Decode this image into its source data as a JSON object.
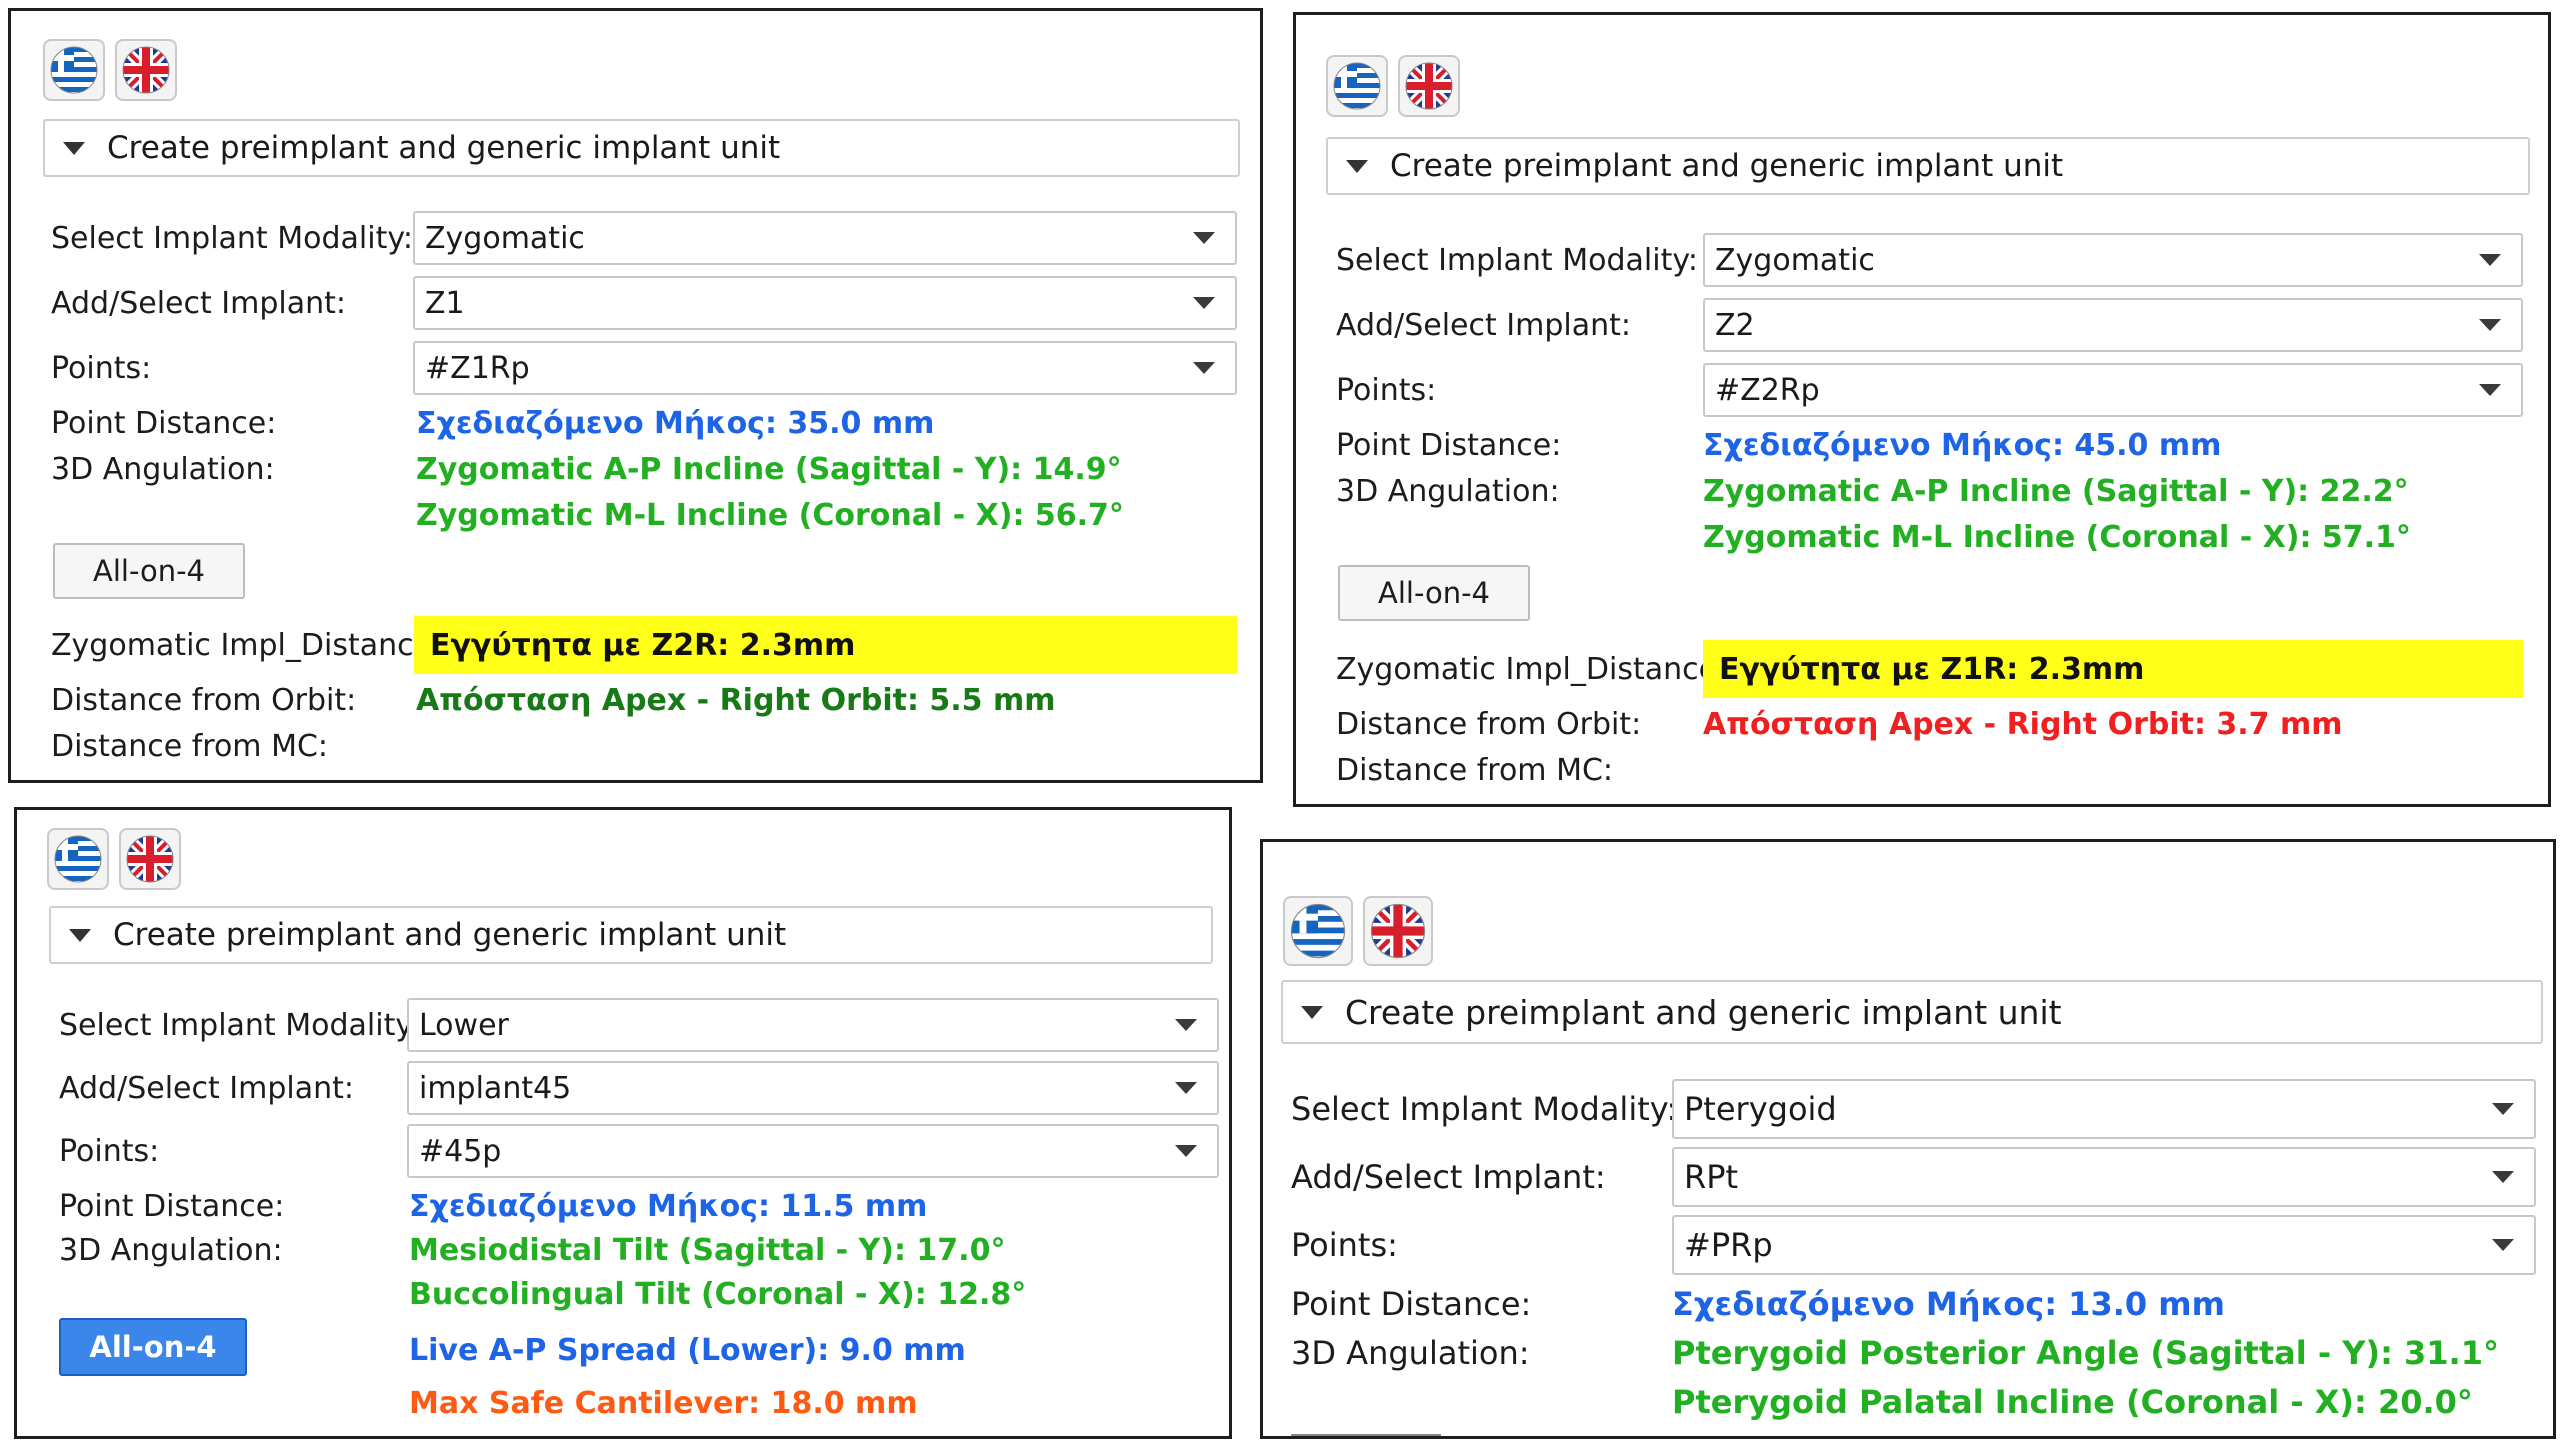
{
  "common": {
    "section_title": "Create preimplant and generic implant unit",
    "labels": {
      "modality": "Select Implant Modality:",
      "implant": "Add/Select Implant:",
      "points": "Points:",
      "point_distance": "Point Distance:",
      "angulation": "3D Angulation:",
      "impl_distance": "Zygomatic Impl_Distance:",
      "orbit": "Distance from Orbit:",
      "mc": "Distance from MC:"
    },
    "all_on_4": "All-on-4",
    "flags": [
      "greek-flag-icon",
      "uk-flag-icon"
    ]
  },
  "panels": [
    {
      "modality": "Zygomatic",
      "implant": "Z1",
      "points": "#Z1Rp",
      "distance_text": "Σχεδιαζόμενο Μήκος: 35.0 mm",
      "angle1": "Zygomatic A-P Incline (Sagittal - Y): 14.9°",
      "angle2": "Zygomatic M-L Incline (Coronal - X): 56.7°",
      "proximity": "Εγγύτητα με Z2R: 2.3mm",
      "orbit_text": "Απόσταση Apex - Right Orbit: 5.5 mm"
    },
    {
      "modality": "Zygomatic",
      "implant": "Z2",
      "points": "#Z2Rp",
      "distance_text": "Σχεδιαζόμενο Μήκος: 45.0 mm",
      "angle1": "Zygomatic A-P Incline (Sagittal - Y): 22.2°",
      "angle2": "Zygomatic M-L Incline (Coronal - X): 57.1°",
      "proximity": "Εγγύτητα με Z1R: 2.3mm",
      "orbit_text": "Απόσταση Apex - Right Orbit: 3.7 mm"
    },
    {
      "modality": "Lower",
      "implant": "implant45",
      "points": "#45p",
      "distance_text": "Σχεδιαζόμενο Μήκος: 11.5 mm",
      "angle1": "Mesiodistal Tilt (Sagittal - Y): 17.0°",
      "angle2": "Buccolingual Tilt (Coronal - X): 12.8°",
      "spread": "Live A-P Spread (Lower): 9.0 mm",
      "cantilever": "Max Safe Cantilever: 18.0 mm"
    },
    {
      "modality": "Pterygoid",
      "implant": "RPt",
      "points": "#PRp",
      "distance_text": "Σχεδιαζόμενο Μήκος: 13.0 mm",
      "angle1": "Pterygoid Posterior Angle (Sagittal - Y): 31.1°",
      "angle2": "Pterygoid Palatal Incline (Coronal - X): 20.0°"
    }
  ]
}
